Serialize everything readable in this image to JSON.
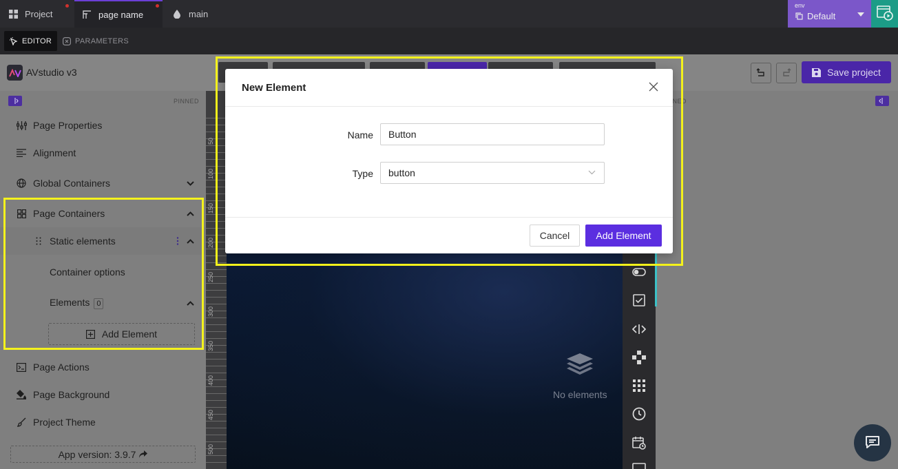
{
  "tabs": [
    {
      "label": "Project",
      "icon": "grid-icon"
    },
    {
      "label": "page name",
      "icon": "layout-icon"
    },
    {
      "label": "main",
      "icon": "drop-icon"
    }
  ],
  "env": {
    "label": "env",
    "value": "Default"
  },
  "subtabs": [
    {
      "label": "EDITOR",
      "icon": "cursor-icon"
    },
    {
      "label": "PARAMETERS",
      "icon": "close-circle-icon"
    }
  ],
  "app": {
    "name": "AVstudio v3",
    "save_label": "Save project"
  },
  "sidebar": {
    "pinned_label": "PINNED",
    "items": [
      {
        "label": "Page Properties",
        "icon": "sliders-icon"
      },
      {
        "label": "Alignment",
        "icon": "align-icon"
      },
      {
        "label": "Global Containers",
        "icon": "globe-icon"
      },
      {
        "label": "Page Containers",
        "icon": "containers-icon"
      },
      {
        "label": "Static elements",
        "icon": "drag-handle-icon"
      },
      {
        "label": "Container options"
      },
      {
        "label": "Elements",
        "badge": "0"
      },
      {
        "label": "Page Actions",
        "icon": "terminal-icon"
      },
      {
        "label": "Page Background",
        "icon": "paint-bucket-icon"
      },
      {
        "label": "Project Theme",
        "icon": "brush-icon"
      }
    ],
    "add_element_label": "Add Element",
    "app_version": "App version: 3.9.7"
  },
  "ruler": {
    "ticks": [
      "50",
      "100",
      "150",
      "200",
      "250",
      "300",
      "350",
      "400",
      "450",
      "500"
    ]
  },
  "canvas": {
    "empty_text": "No elements"
  },
  "right_panel": {
    "pinned_label": "PINNED"
  },
  "modal": {
    "title": "New Element",
    "name_label": "Name",
    "name_value": "Button",
    "type_label": "Type",
    "type_value": "button",
    "cancel_label": "Cancel",
    "submit_label": "Add Element"
  },
  "colors": {
    "accent": "#5b2ee0",
    "highlight": "#f4f21c",
    "env_bg": "#7b57c9",
    "run_bg": "#1c9c87"
  }
}
